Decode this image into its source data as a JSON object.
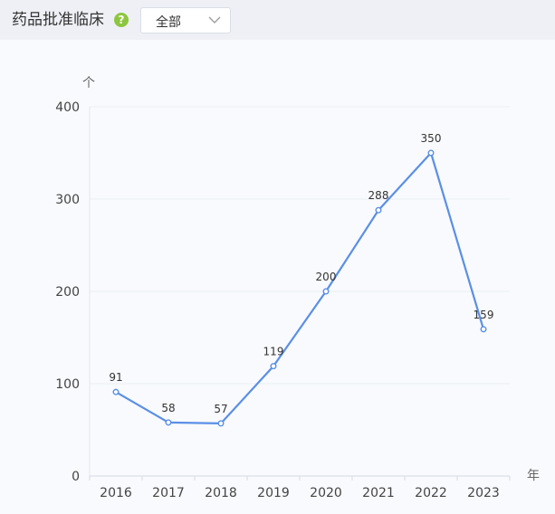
{
  "header": {
    "title": "药品批准临床",
    "help_icon": "question-circle-icon",
    "help_glyph": "?",
    "filter": {
      "value": "全部",
      "icon": "chevron-down-icon"
    }
  },
  "colors": {
    "line": "#5b8fe6",
    "help_badge": "#8dc63f"
  },
  "chart_data": {
    "type": "line",
    "categories": [
      "2016",
      "2017",
      "2018",
      "2019",
      "2020",
      "2021",
      "2022",
      "2023"
    ],
    "series": [
      {
        "values": [
          91,
          58,
          57,
          119,
          200,
          288,
          350,
          159
        ]
      }
    ],
    "y_unit_label": "个",
    "x_unit_label": "年",
    "yticks": [
      0,
      100,
      200,
      300,
      400
    ],
    "ylim": [
      0,
      400
    ],
    "grid": true,
    "data_labels": true
  }
}
